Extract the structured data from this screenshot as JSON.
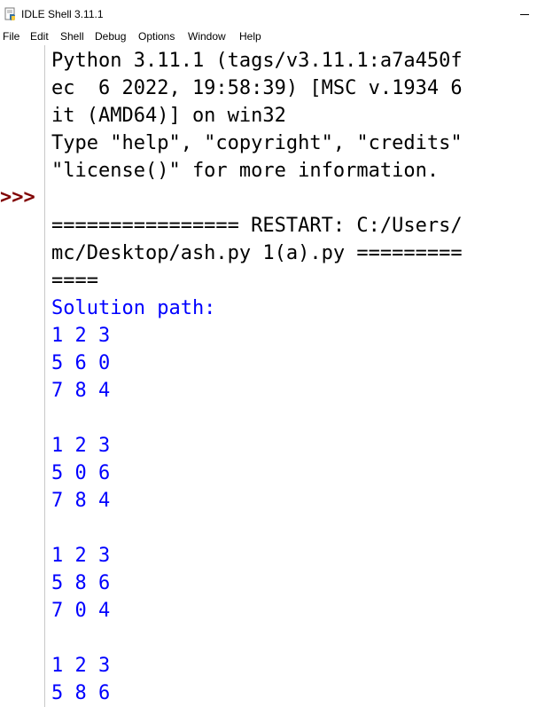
{
  "window": {
    "title": "IDLE Shell 3.11.1",
    "icon": "python-idle-icon"
  },
  "menu": [
    "File",
    "Edit",
    "Shell",
    "Debug",
    "Options",
    "Window",
    "Help"
  ],
  "gutter": {
    "prompt": ">>>"
  },
  "shell": {
    "lines": [
      {
        "text": "Python 3.11.1 (tags/v3.11.1:a7a450f",
        "color": "black"
      },
      {
        "text": "ec  6 2022, 19:58:39) [MSC v.1934 6",
        "color": "black"
      },
      {
        "text": "it (AMD64)] on win32",
        "color": "black"
      },
      {
        "text": "Type \"help\", \"copyright\", \"credits\"",
        "color": "black"
      },
      {
        "text": "\"license()\" for more information.",
        "color": "black"
      },
      {
        "text": "",
        "color": "black"
      },
      {
        "text": "================ RESTART: C:/Users/",
        "color": "black"
      },
      {
        "text": "mc/Desktop/ash.py 1(a).py =========",
        "color": "black"
      },
      {
        "text": "====",
        "color": "black"
      },
      {
        "text": "Solution path:",
        "color": "blue"
      },
      {
        "text": "1 2 3",
        "color": "blue"
      },
      {
        "text": "5 6 0",
        "color": "blue"
      },
      {
        "text": "7 8 4",
        "color": "blue"
      },
      {
        "text": "",
        "color": "blue"
      },
      {
        "text": "1 2 3",
        "color": "blue"
      },
      {
        "text": "5 0 6",
        "color": "blue"
      },
      {
        "text": "7 8 4",
        "color": "blue"
      },
      {
        "text": "",
        "color": "blue"
      },
      {
        "text": "1 2 3",
        "color": "blue"
      },
      {
        "text": "5 8 6",
        "color": "blue"
      },
      {
        "text": "7 0 4",
        "color": "blue"
      },
      {
        "text": "",
        "color": "blue"
      },
      {
        "text": "1 2 3",
        "color": "blue"
      },
      {
        "text": "5 8 6",
        "color": "blue"
      }
    ]
  },
  "colors": {
    "output_blue": "#0000ff",
    "prompt_maroon": "#800000",
    "text_black": "#000000"
  }
}
